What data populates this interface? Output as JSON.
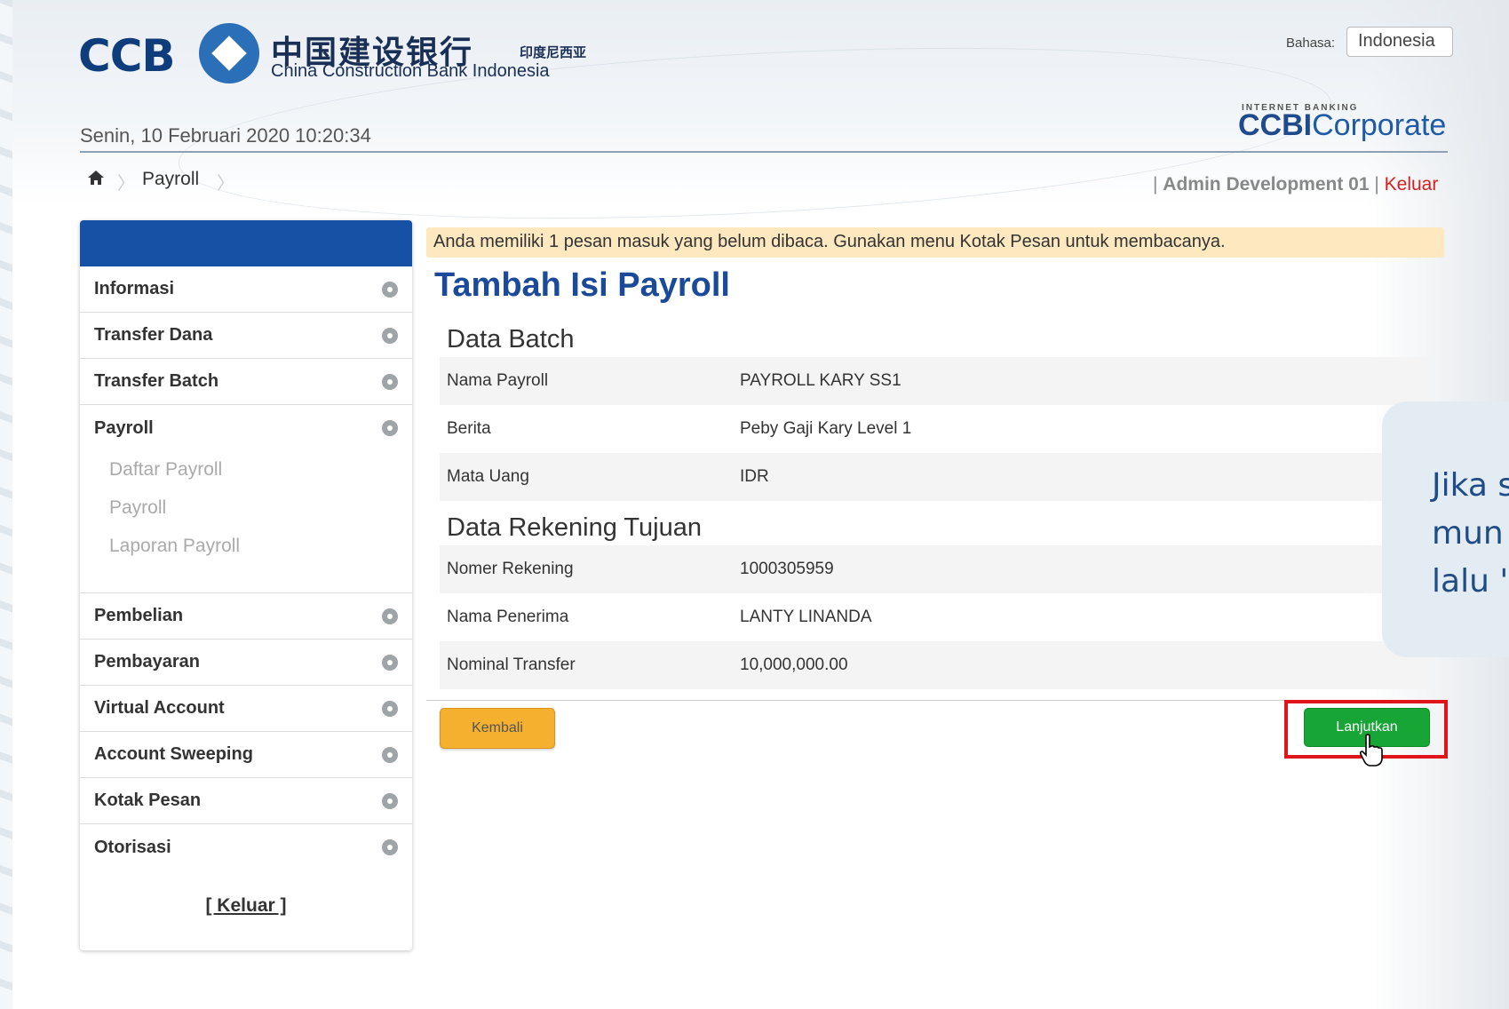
{
  "header": {
    "brand_latin": "CCB",
    "brand_chinese": "中国建设银行",
    "brand_chinese_small": "印度尼西亚",
    "brand_english": "China Construction Bank Indonesia",
    "language_label": "Bahasa:",
    "language_value": "Indonesia",
    "product_small": "INTERNET BANKING",
    "product_bold": "CCBI",
    "product_light": "Corporate",
    "datetime": "Senin, 10 Februari 2020 10:20:34"
  },
  "breadcrumb": {
    "current": "Payroll"
  },
  "user": {
    "prefix": "| ",
    "name": "Admin Development 01",
    "separator": " | ",
    "logout": "Keluar"
  },
  "sidebar": {
    "items": [
      {
        "label": "Informasi"
      },
      {
        "label": "Transfer Dana"
      },
      {
        "label": "Transfer Batch"
      },
      {
        "label": "Payroll"
      },
      {
        "label": "Pembelian"
      },
      {
        "label": "Pembayaran"
      },
      {
        "label": "Virtual Account"
      },
      {
        "label": "Account Sweeping"
      },
      {
        "label": "Kotak Pesan"
      },
      {
        "label": "Otorisasi"
      }
    ],
    "payroll_sub": [
      "Daftar Payroll",
      "Payroll",
      "Laporan Payroll"
    ],
    "logout": "[ Keluar ]"
  },
  "main": {
    "notice": "Anda memiliki 1 pesan masuk yang belum dibaca. Gunakan menu Kotak Pesan untuk membacanya.",
    "title": "Tambah Isi Payroll",
    "batch_title": "Data Batch",
    "batch_rows": [
      {
        "label": "Nama Payroll",
        "value": "PAYROLL KARY SS1"
      },
      {
        "label": "Berita",
        "value": "Peby Gaji Kary Level 1"
      },
      {
        "label": "Mata Uang",
        "value": "IDR"
      }
    ],
    "dest_title": "Data Rekening Tujuan",
    "dest_rows": [
      {
        "label": "Nomer Rekening",
        "value": "1000305959"
      },
      {
        "label": "Nama Penerima",
        "value": "LANTY LINANDA"
      },
      {
        "label": "Nominal Transfer",
        "value": "10,000,000.00"
      }
    ],
    "back_button": "Kembali",
    "next_button": "Lanjutkan"
  },
  "callout": {
    "lines": [
      "Jika s",
      "mun",
      "lalu '"
    ]
  },
  "colors": {
    "brand_blue": "#1651a6",
    "title_blue": "#1a4a99",
    "notice_bg": "#fde8c0",
    "back_orange": "#f5b030",
    "next_green": "#17a535",
    "highlight_red": "#e0141b",
    "logout_red": "#d41f1f"
  }
}
